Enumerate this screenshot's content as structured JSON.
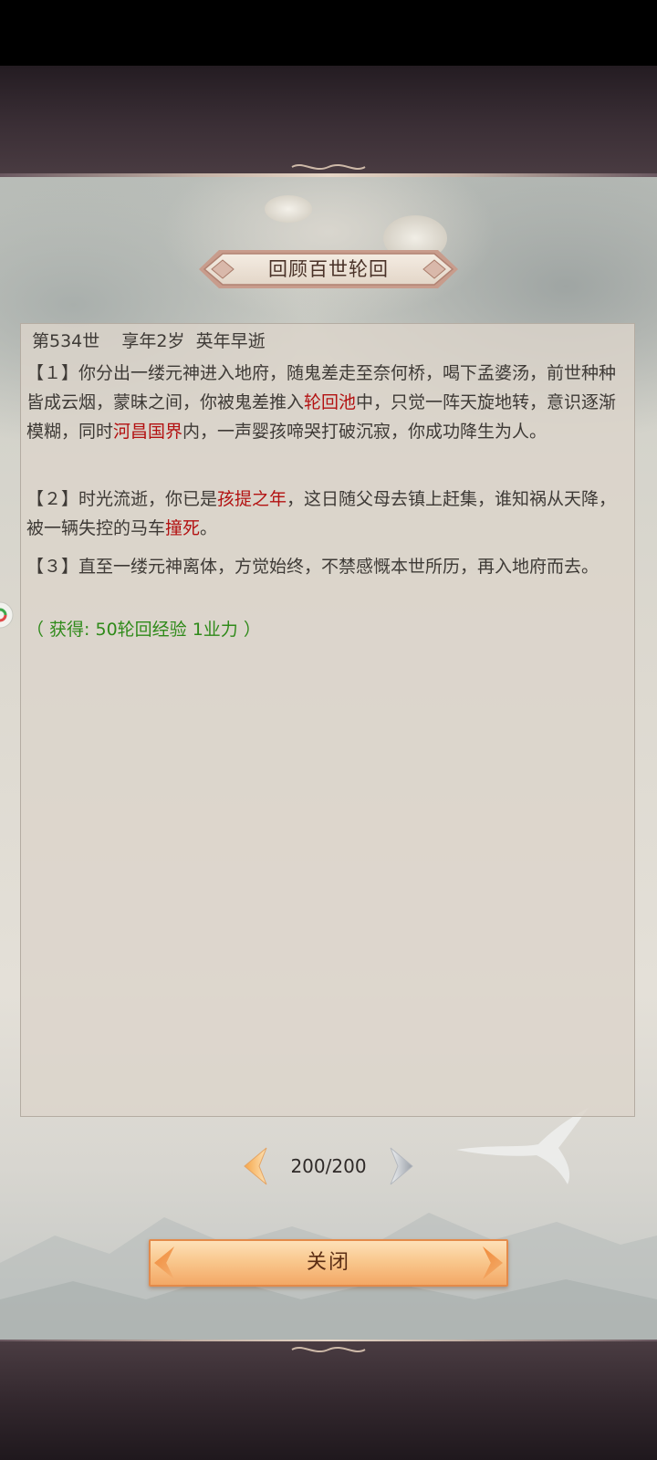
{
  "dialog": {
    "title": "回顾百世轮回",
    "header": "第534世    享年2岁  英年早逝",
    "entries": [
      {
        "parts": [
          "【１】你分出一缕元神进入地府，随鬼差走至奈何桥，喝下孟婆汤，前世种种皆成云烟，蒙昧之间，你被鬼差推入",
          "轮回池",
          "中，只觉一阵天旋地转，意识逐渐模糊，同时",
          "河昌国界",
          "内，一声婴孩啼哭打破沉寂，你成功降生为人。"
        ]
      },
      {
        "parts": [
          "【２】时光流逝，你已是",
          "孩提之年",
          "，这日随父母去镇上赶集，谁知祸从天降，被一辆失控的马车",
          "撞死",
          "。"
        ]
      },
      {
        "parts": [
          "【３】直至一缕元神离体，方觉始终，不禁感慨本世所历，再入地府而去。"
        ]
      }
    ],
    "reward": "（ 获得: 50轮回经验 1业力 ）",
    "pager": {
      "text": "200/200",
      "prev_icon": "chevron-left-icon",
      "next_icon": "chevron-right-icon"
    },
    "close_label": "关闭"
  },
  "colors": {
    "highlight": "#b31111",
    "reward": "#2f8a1a",
    "button": "#f9c88e"
  }
}
